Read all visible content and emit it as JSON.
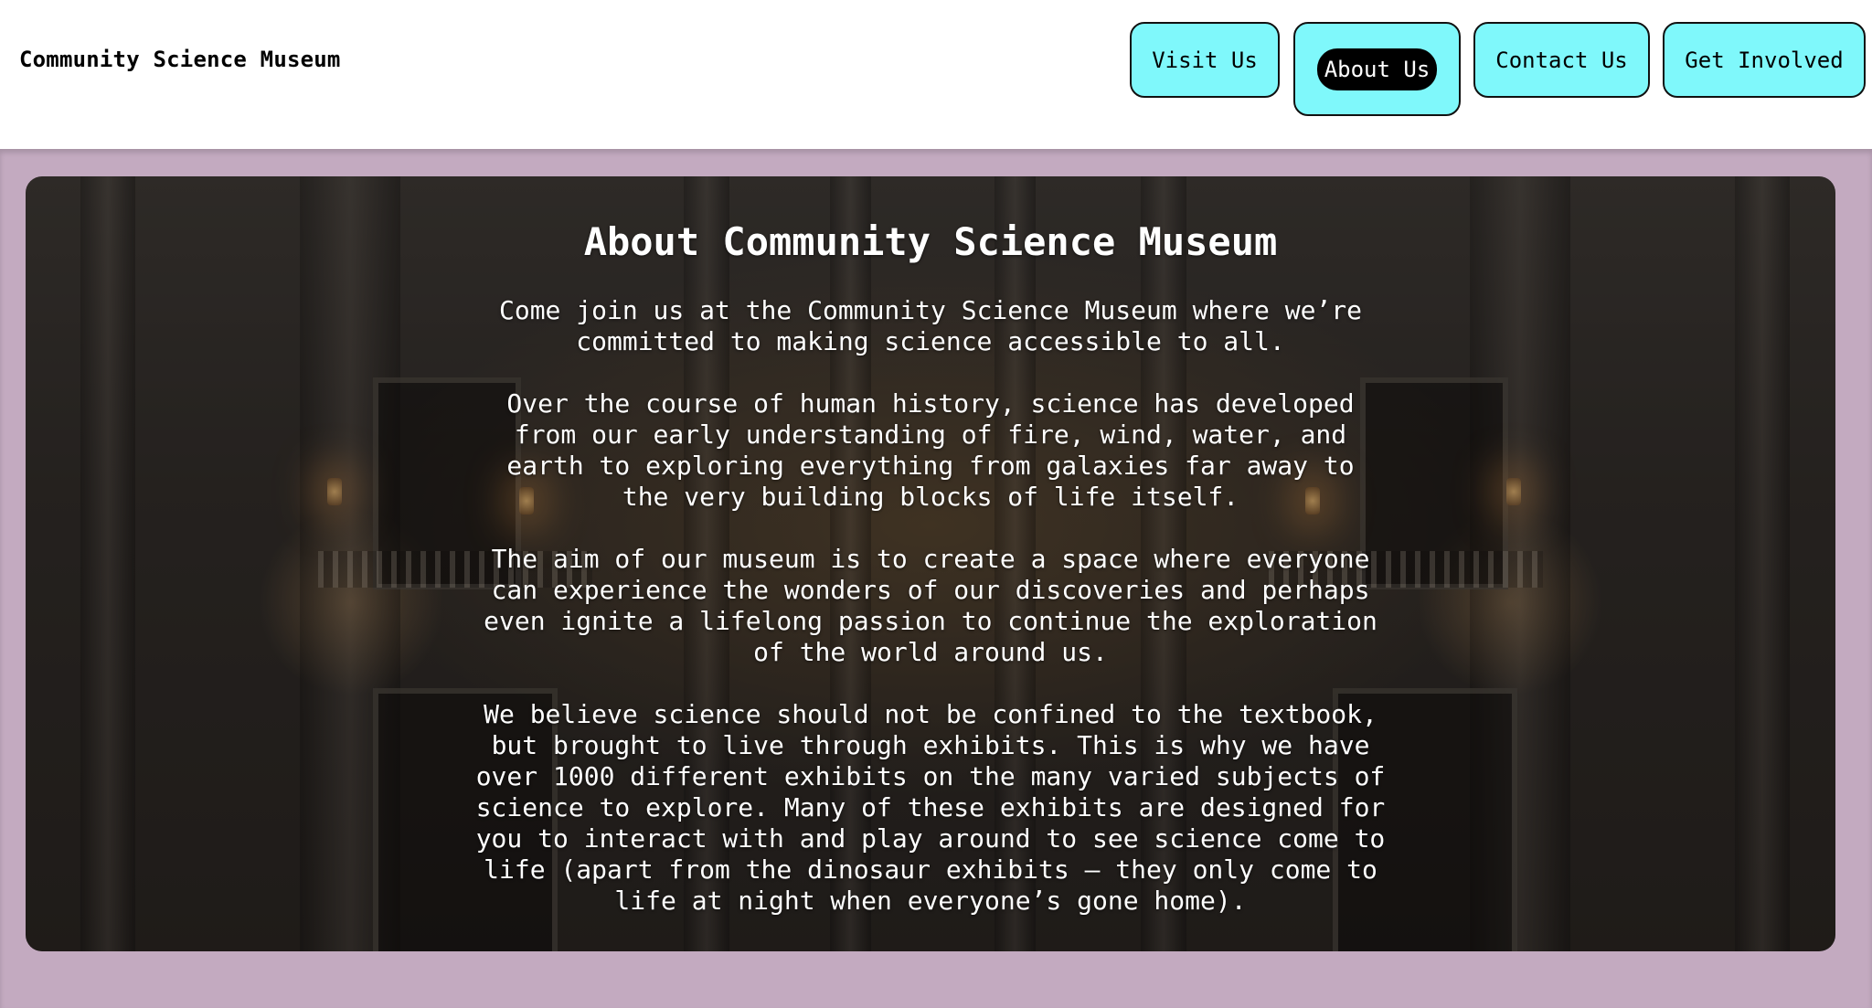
{
  "header": {
    "site_title": "Community Science Museum",
    "nav": [
      {
        "label": "Visit Us",
        "active": false
      },
      {
        "label": "About Us",
        "active": true
      },
      {
        "label": "Contact Us",
        "active": false
      },
      {
        "label": "Get Involved",
        "active": false
      }
    ]
  },
  "about": {
    "title": "About Community Science Museum",
    "paragraphs": [
      "Come join us at the Community Science Museum where we’re committed to making science accessible to all.",
      "Over the course of human history, science has developed from our early understanding of fire, wind, water, and earth to exploring everything from galaxies far away to the very building blocks of life itself.",
      "The aim of our museum is to create a space where everyone can experience the wonders of our discoveries and perhaps even ignite a lifelong passion to continue the exploration of the world around us.",
      "We believe science should not be confined to the textbook, but brought to live through exhibits. This is why we have over 1000 different exhibits on the many varied subjects of science to explore. Many of these exhibits are designed for you to interact with and play around to see science come to life (apart from the dinosaur exhibits – they only come to life at night when everyone’s gone home)."
    ]
  },
  "colors": {
    "nav_button_bg": "#7ff8fb",
    "band_bg": "#c3aac0",
    "active_pill_bg": "#000000"
  }
}
